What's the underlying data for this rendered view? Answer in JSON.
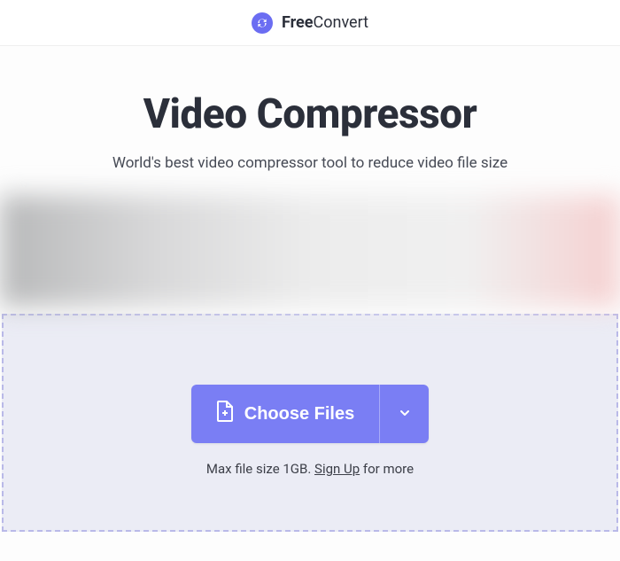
{
  "header": {
    "brand_bold": "Free",
    "brand_rest": "Convert"
  },
  "hero": {
    "title": "Video Compressor",
    "subtitle": "World's best video compressor tool to reduce video file size"
  },
  "upload": {
    "choose_label": "Choose Files",
    "max_prefix": "Max file size 1GB. ",
    "signup_label": "Sign Up",
    "max_suffix": " for more"
  }
}
